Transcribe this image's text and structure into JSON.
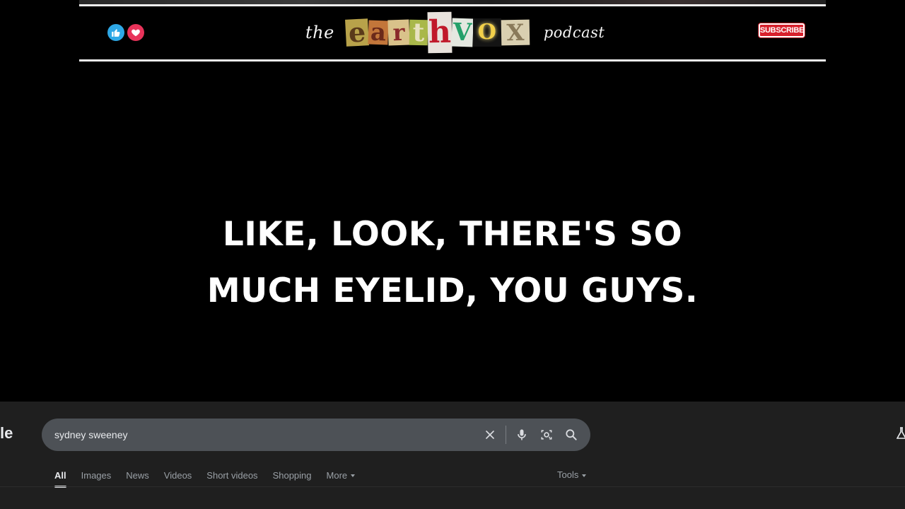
{
  "banner": {
    "brand_prefix": "the",
    "brand_suffix": "podcast",
    "logo_letters": [
      {
        "char": "e",
        "bg": "#b8a24a",
        "fg": "#5a3a1a"
      },
      {
        "char": "a",
        "bg": "#c2763a",
        "fg": "#6b2a1a"
      },
      {
        "char": "r",
        "bg": "#d9c28a",
        "fg": "#8a2a2a"
      },
      {
        "char": "t",
        "bg": "#a9b84a",
        "fg": "#e8e2c0"
      },
      {
        "char": "h",
        "bg": "#e8e2dc",
        "fg": "#c0182a"
      },
      {
        "char": "V",
        "bg": "#e4e8e0",
        "fg": "#23a06a"
      },
      {
        "char": "O",
        "bg": "#141414",
        "fg": "#f2d04a"
      },
      {
        "char": "X",
        "bg": "#d9cfb0",
        "fg": "#8a7a5a"
      }
    ],
    "subscribe_label": "SUBSCRIBE",
    "icons": {
      "like": "thumbs-up-icon",
      "heart": "heart-icon"
    },
    "colors": {
      "like": "#2ea8e6",
      "heart": "#e8335a",
      "subscribe": "#d8202c"
    }
  },
  "caption": {
    "line1": "LIKE, LOOK, THERE'S SO",
    "line2": "MUCH EYELID, YOU GUYS."
  },
  "search": {
    "brand_fragment": "le",
    "query": "sydney sweeney",
    "icons": [
      "clear-icon",
      "microphone-icon",
      "camera-lens-icon",
      "search-icon"
    ],
    "tabs": [
      {
        "label": "All",
        "active": true
      },
      {
        "label": "Images",
        "active": false
      },
      {
        "label": "News",
        "active": false
      },
      {
        "label": "Videos",
        "active": false
      },
      {
        "label": "Short videos",
        "active": false
      },
      {
        "label": "Shopping",
        "active": false
      },
      {
        "label": "More",
        "active": false
      }
    ],
    "tools_label": "Tools"
  }
}
